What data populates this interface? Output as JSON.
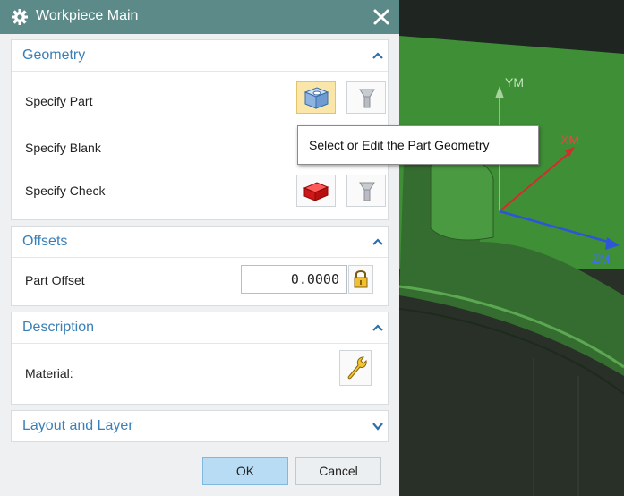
{
  "dialog": {
    "title": "Workpiece Main",
    "close_icon": "close-icon",
    "title_icon": "gear-icon"
  },
  "geometry": {
    "header": "Geometry",
    "rows": [
      {
        "label": "Specify Part"
      },
      {
        "label": "Specify Blank"
      },
      {
        "label": "Specify Check"
      }
    ],
    "tooltip": "Select or Edit the Part Geometry"
  },
  "offsets": {
    "header": "Offsets",
    "part_offset_label": "Part Offset",
    "part_offset_value": "0.0000"
  },
  "description": {
    "header": "Description",
    "material_label": "Material:"
  },
  "layout": {
    "header": "Layout and Layer"
  },
  "buttons": {
    "ok": "OK",
    "cancel": "Cancel"
  },
  "viewport": {
    "axis_labels": {
      "ym": "YM",
      "xm": "XM",
      "zm": "ZM"
    }
  },
  "colors": {
    "title_bar": "#5b8a88",
    "section_header": "#3a7fb6",
    "active_button": "#fbe6a9",
    "ok_button": "#b8dcf3",
    "model_green": "#3c8a34"
  }
}
